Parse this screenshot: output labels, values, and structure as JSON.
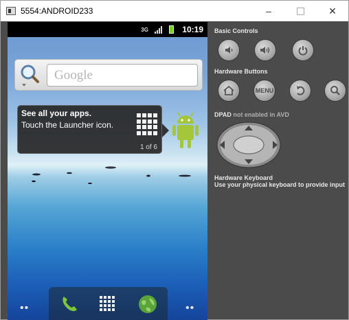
{
  "window": {
    "title": "5554:ANDROID233",
    "controls": {
      "minimize": "–",
      "close": "✕"
    }
  },
  "status_bar": {
    "network_label": "3G",
    "time": "10:19"
  },
  "search_widget": {
    "placeholder": "Google",
    "icon": "magnifier-icon"
  },
  "tooltip": {
    "title": "See all your apps.",
    "body": "Touch the Launcher icon.",
    "page": "1 of 6"
  },
  "dock": {
    "items": [
      "phone-icon",
      "app-drawer-icon",
      "browser-icon"
    ]
  },
  "controls": {
    "basic_label": "Basic Controls",
    "basic_buttons": [
      "volume-down-icon",
      "volume-up-icon",
      "power-icon"
    ],
    "hardware_label": "Hardware Buttons",
    "hardware_buttons": [
      "home-icon",
      "menu-button",
      "back-icon",
      "search-icon"
    ],
    "menu_label": "MENU",
    "dpad_label_strong": "DPAD",
    "dpad_label_rest": " not enabled in AVD",
    "keyboard_title": "Hardware Keyboard",
    "keyboard_hint": "Use your physical keyboard to provide input"
  },
  "colors": {
    "panel_bg": "#4b4b4b",
    "droid_green": "#a4c639",
    "status_bar_bg": "#000000"
  }
}
